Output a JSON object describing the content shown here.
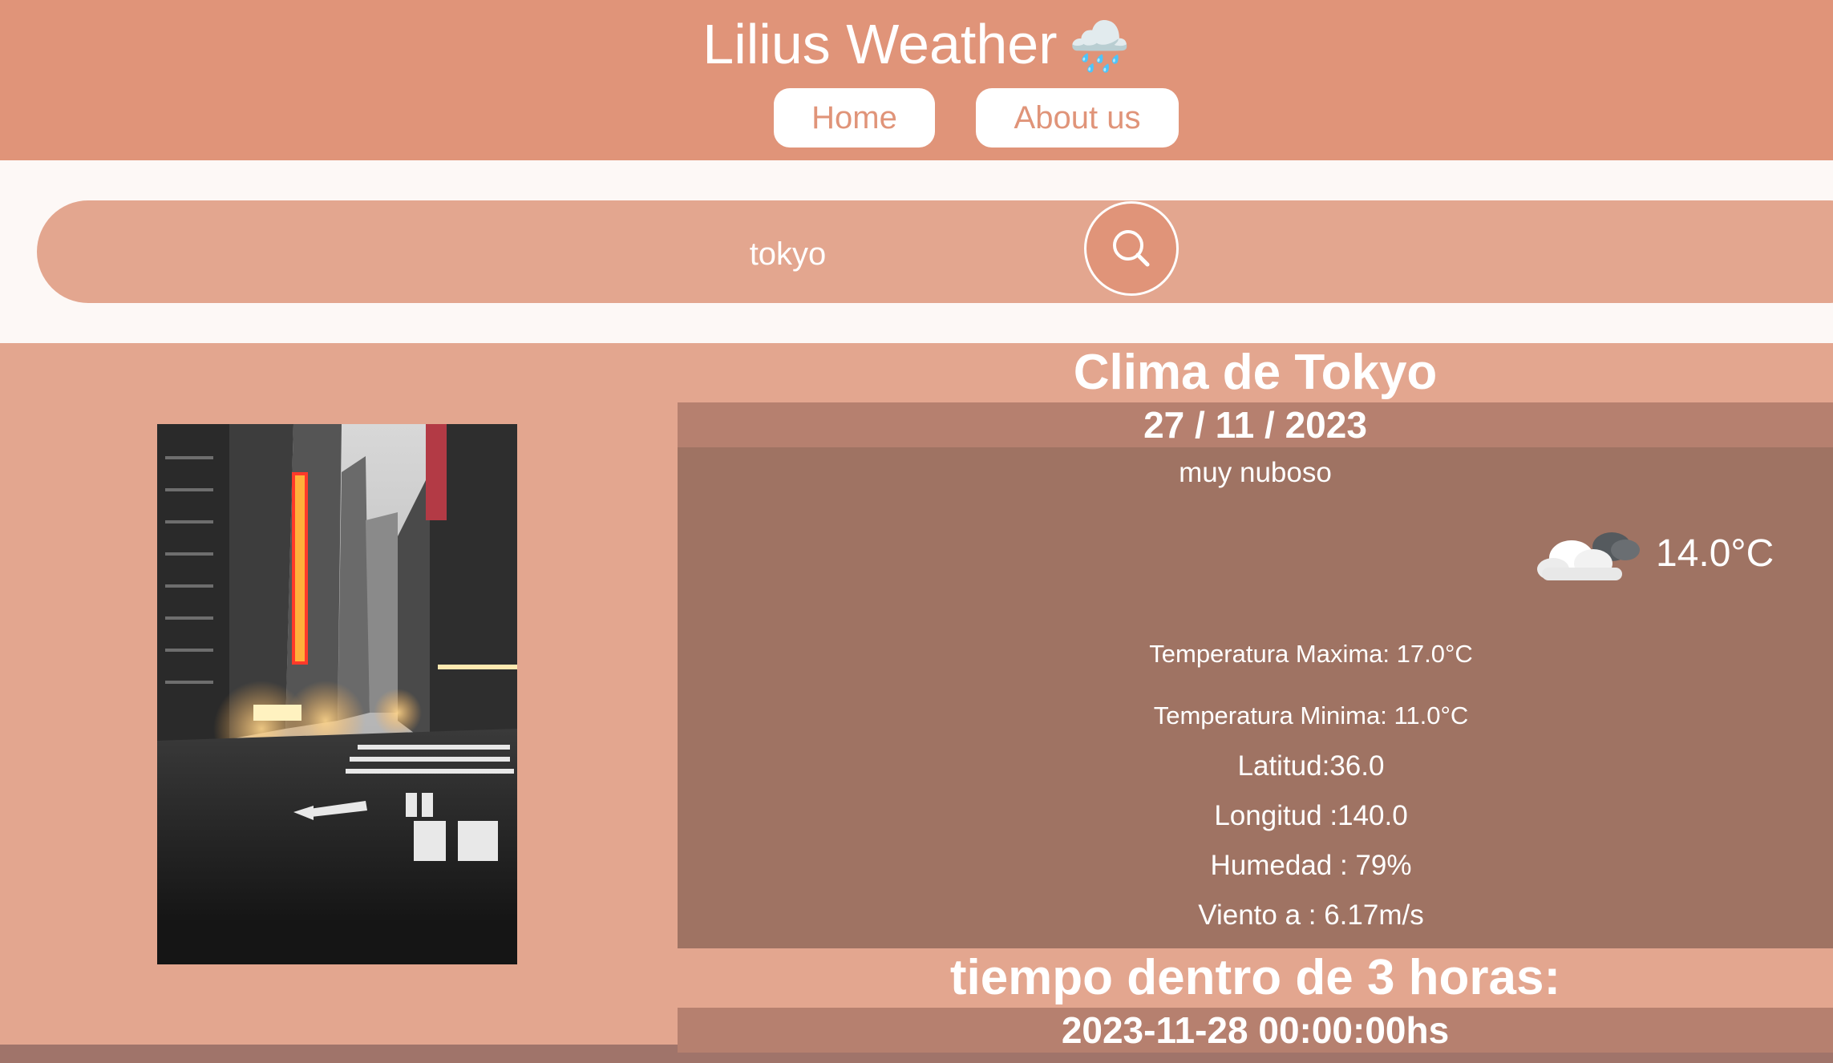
{
  "header": {
    "title": "Lilius Weather",
    "title_icon": "cloud-rain-icon",
    "nav": [
      {
        "label": "Home"
      },
      {
        "label": "About us"
      }
    ]
  },
  "search": {
    "value": "tokyo",
    "button_icon": "search-icon"
  },
  "current": {
    "heading": "Clima de Tokyo",
    "date": "27 / 11 / 2023",
    "description": "muy nuboso",
    "weather_icon": "cloudy-icon",
    "temperature": "14.0°C",
    "max_temp": "Temperatura Maxima: 17.0°C",
    "min_temp": "Temperatura Minima: 11.0°C",
    "latitude": "Latitud:36.0",
    "longitude": "Longitud :140.0",
    "humidity": "Humedad : 79%",
    "wind": "Viento a : 6.17m/s"
  },
  "forecast": {
    "heading": "tiempo dentro de 3 horas:",
    "datetime": "2023-11-28 00:00:00hs"
  },
  "colors": {
    "header": "#e09479",
    "panel": "#e3a68f",
    "date_bar": "#b6806f",
    "info_box": "#9f7363"
  }
}
